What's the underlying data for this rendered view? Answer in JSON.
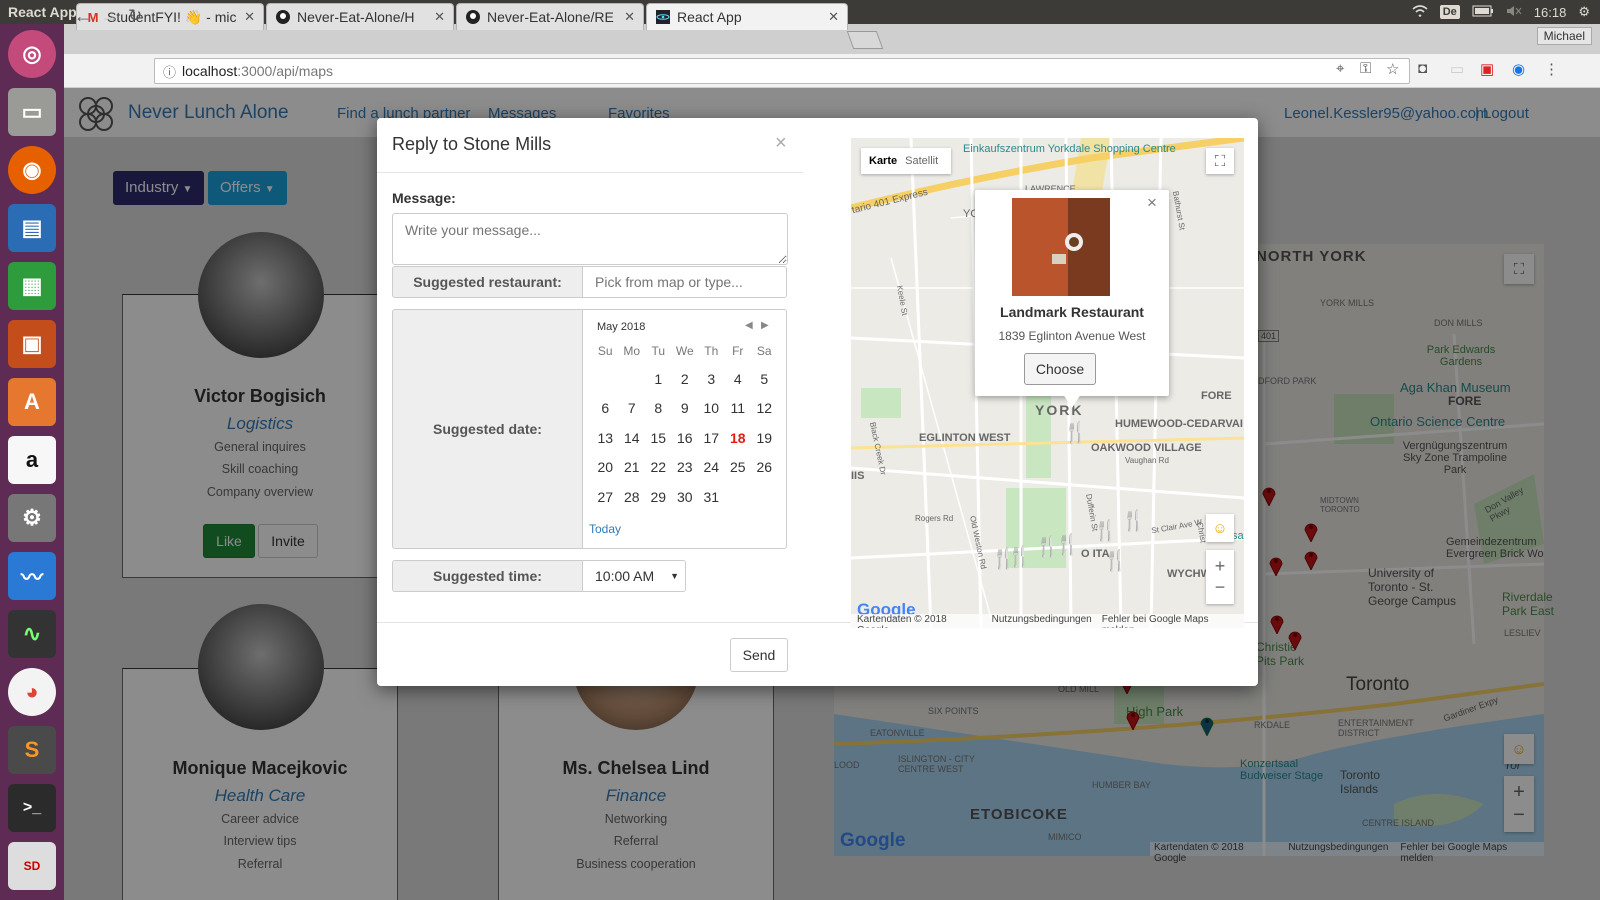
{
  "os": {
    "window_title": "React App - Google Chrome",
    "keyboard_layout": "De",
    "time": "16:18"
  },
  "launcher": {
    "items": [
      "ubuntu-icon",
      "files-icon",
      "firefox-icon",
      "writer-icon",
      "calc-icon",
      "impress-icon",
      "software-center-icon",
      "amazon-icon",
      "settings-icon",
      "monitor-icon",
      "system-monitor-icon",
      "chrome-icon",
      "sublime-icon",
      "terminal-icon",
      "sd-card-icon"
    ]
  },
  "browser": {
    "tabs": [
      {
        "title": "StudentFYI! 👋 - mic",
        "icon": "M"
      },
      {
        "title": "Never-Eat-Alone/H",
        "icon": "github"
      },
      {
        "title": "Never-Eat-Alone/RE",
        "icon": "github"
      },
      {
        "title": "React App",
        "icon": "react",
        "active": true
      }
    ],
    "profile": "Michael",
    "url_host": "localhost",
    "url_path": ":3000/api/maps"
  },
  "navbar": {
    "brand": "Never Lunch Alone",
    "links": [
      "Find a lunch partner",
      "Messages",
      "Favorites"
    ],
    "user_email": "Leonel.Kessler95@yahoo.com",
    "separator": "|",
    "logout": "Logout"
  },
  "filters": {
    "industry": "Industry",
    "offers": "Offers"
  },
  "cards": [
    {
      "name": "Victor Bogisich",
      "industry": "Logistics",
      "tags": [
        "General inquires",
        "Skill coaching",
        "Company overview"
      ],
      "like": "Like",
      "invite": "Invite"
    },
    {
      "name": "Monique Macejkovic",
      "industry": "Health Care",
      "tags": [
        "Career advice",
        "Interview tips",
        "Referral"
      ]
    },
    {
      "name": "Ms. Chelsea Lind",
      "industry": "Finance",
      "tags": [
        "Networking",
        "Referral",
        "Business cooperation"
      ]
    }
  ],
  "bg_map": {
    "labels": [
      "NORTH YORK",
      "YORK MILLS",
      "DON MILLS",
      "BEDFORD PARK",
      "Park Edwards Gardens",
      "Aga Khan Museum",
      "Ontario Science Centre",
      "Vergnügungszentrum Sky Zone Trampoline Park",
      "MIDTOWN TORONTO",
      "Don Valley Pkwy",
      "Gemeindezentrum Evergreen Brick Wo",
      "University of Toronto - St. George Campus",
      "Riverdale Park East",
      "LESLIEV",
      "Christie Pits Park",
      "Toronto",
      "ENTERTAINMENT DISTRICT",
      "Gardiner Expy",
      "OLD MILL",
      "High Park",
      "SIX POINTS",
      "EATONVILLE",
      "ISLINGTON - CITY CENTRE WEST",
      "HUMBER BAY",
      "Konzertsaal Budweiser Stage",
      "Toronto Islands",
      "ETOBICOKE",
      "MIMICO",
      "CENTRE ISLAND",
      "FORE",
      "Tor",
      "401",
      "RKDALE",
      "LOOD"
    ],
    "attribution": [
      "Kartendaten © 2018 Google",
      "Nutzungsbedingungen",
      "Fehler bei Google Maps melden"
    ],
    "logo": "Google"
  },
  "modal": {
    "title": "Reply to Stone Mills",
    "close": "×",
    "message_label": "Message:",
    "message_placeholder": "Write your message...",
    "restaurant_label": "Suggested restaurant:",
    "restaurant_placeholder": "Pick from map or type...",
    "date_label": "Suggested date:",
    "calendar": {
      "month": "May 2018",
      "weekdays": [
        "Su",
        "Mo",
        "Tu",
        "We",
        "Th",
        "Fr",
        "Sa"
      ],
      "weeks": [
        [
          "",
          "",
          "1",
          "2",
          "3",
          "4",
          "5"
        ],
        [
          "6",
          "7",
          "8",
          "9",
          "10",
          "11",
          "12"
        ],
        [
          "13",
          "14",
          "15",
          "16",
          "17",
          "18",
          "19"
        ],
        [
          "20",
          "21",
          "22",
          "23",
          "24",
          "25",
          "26"
        ],
        [
          "27",
          "28",
          "29",
          "30",
          "31",
          "",
          ""
        ]
      ],
      "today_day": "18",
      "today_color": "#e41b17",
      "today_link": "Today"
    },
    "time_label": "Suggested time:",
    "time_value": "10:00 AM",
    "send": "Send"
  },
  "modal_map": {
    "tabs": [
      "Karte",
      "Satellit"
    ],
    "labels": [
      "Einkaufszentrum Yorkdale Shopping Centre",
      "LAWRENCE",
      "tario 401 Express",
      "YO",
      "Keele St",
      "Bathurst St",
      "EGLINTON WEST",
      "YORK",
      "HUMEWOOD-CEDARVAI",
      "FORE",
      "OAKWOOD VILLAGE",
      "Vaughan Rd",
      "Black Creek Dr",
      "Rogers Rd",
      "IIS",
      "Old Weston Rd",
      "Dufferin St",
      "St Clair Ave W",
      "WYCHWO",
      "O ITA",
      "sa",
      "Christ"
    ],
    "popup": {
      "name": "Landmark Restaurant",
      "address": "1839 Eglinton Avenue West",
      "choose": "Choose",
      "close": "×"
    },
    "attribution": [
      "Kartendaten © 2018 Google",
      "Nutzungsbedingungen",
      "Fehler bei Google Maps melden"
    ],
    "logo": "Google"
  },
  "colors": {
    "brand": "#337ab7",
    "industry_btn": "#2e2a6e",
    "offers_btn": "#1aa3dc",
    "like_btn": "#1f8b3a",
    "pin_red": "#c4141a",
    "pin_blue": "#1b5c7e"
  }
}
